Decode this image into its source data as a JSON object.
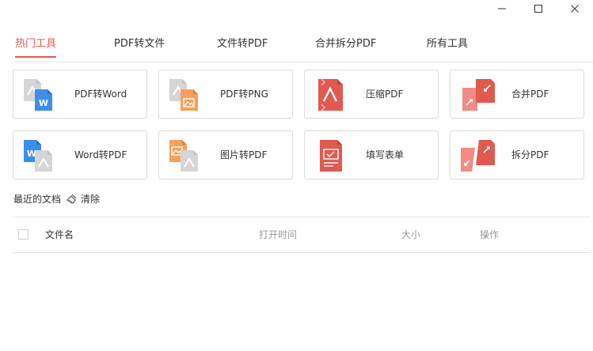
{
  "window": {
    "controls": [
      "minimize-icon",
      "maximize-icon",
      "close-icon"
    ]
  },
  "tabs": [
    {
      "label": "热门工具",
      "active": true
    },
    {
      "label": "PDF转文件",
      "active": false
    },
    {
      "label": "文件转PDF",
      "active": false
    },
    {
      "label": "合并拆分PDF",
      "active": false
    },
    {
      "label": "所有工具",
      "active": false
    }
  ],
  "tools": [
    {
      "label": "PDF转Word",
      "icon": "pdf-to-word-icon"
    },
    {
      "label": "PDF转PNG",
      "icon": "pdf-to-png-icon"
    },
    {
      "label": "压缩PDF",
      "icon": "compress-pdf-icon"
    },
    {
      "label": "合并PDF",
      "icon": "merge-pdf-icon"
    },
    {
      "label": "Word转PDF",
      "icon": "word-to-pdf-icon"
    },
    {
      "label": "图片转PDF",
      "icon": "image-to-pdf-icon"
    },
    {
      "label": "填写表单",
      "icon": "fill-form-icon"
    },
    {
      "label": "拆分PDF",
      "icon": "split-pdf-icon"
    }
  ],
  "recent": {
    "title": "最近的文档",
    "clear_label": "清除"
  },
  "table": {
    "col_name": "文件名",
    "col_open_time": "打开时间",
    "col_size": "大小",
    "col_action": "操作"
  },
  "colors": {
    "accent": "#e05a50",
    "word_blue": "#3d8ee8",
    "image_orange": "#f5a15b",
    "pdf_red": "#e05a50",
    "pdf_pink": "#f28a86",
    "gray_doc": "#d6d6d6"
  }
}
